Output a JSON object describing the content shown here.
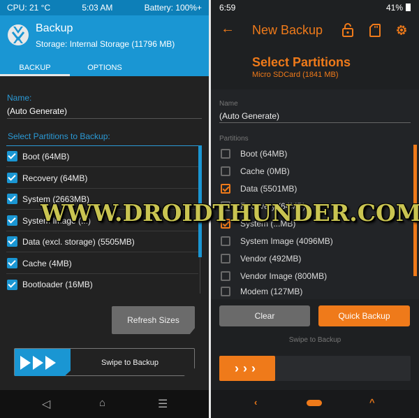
{
  "left": {
    "status": {
      "cpu": "CPU: 21 °C",
      "time": "5:03 AM",
      "battery": "Battery: 100%+"
    },
    "header": {
      "title": "Backup",
      "storage": "Storage: Internal Storage (11796 MB)"
    },
    "tabs": [
      {
        "label": "BACKUP",
        "active": true
      },
      {
        "label": "OPTIONS",
        "active": false
      }
    ],
    "name_label": "Name:",
    "name_value": "(Auto Generate)",
    "partitions_label": "Select Partitions to Backup:",
    "partitions": [
      {
        "label": "Boot (64MB)",
        "checked": true
      },
      {
        "label": "Recovery (64MB)",
        "checked": true
      },
      {
        "label": "System (2663MB)",
        "checked": true
      },
      {
        "label": "System Image (...)",
        "checked": true
      },
      {
        "label": "Data (excl. storage) (5505MB)",
        "checked": true
      },
      {
        "label": "Cache (4MB)",
        "checked": true
      },
      {
        "label": "Bootloader (16MB)",
        "checked": true
      }
    ],
    "refresh_button": "Refresh Sizes",
    "swipe_label": "Swipe to Backup",
    "accent": "#1a96d3"
  },
  "right": {
    "status": {
      "time": "6:59",
      "battery": "41%"
    },
    "title": "New Backup",
    "icons": [
      "back-arrow-icon",
      "unlock-icon",
      "sdcard-icon",
      "gear-icon"
    ],
    "section_title": "Select Partitions",
    "section_sub": "Micro SDCard (1841 MB)",
    "name_label": "Name",
    "name_value": "(Auto Generate)",
    "partitions_label": "Partitions",
    "partitions": [
      {
        "label": "Boot (64MB)",
        "checked": false
      },
      {
        "label": "Cache (0MB)",
        "checked": false
      },
      {
        "label": "Data (5501MB)",
        "checked": true
      },
      {
        "label": "Recovery (64MB)",
        "checked": false
      },
      {
        "label": "System (...MB)",
        "checked": true
      },
      {
        "label": "System Image (4096MB)",
        "checked": false
      },
      {
        "label": "Vendor (492MB)",
        "checked": false
      },
      {
        "label": "Vendor Image (800MB)",
        "checked": false
      },
      {
        "label": "Modem (127MB)",
        "checked": false
      }
    ],
    "clear_button": "Clear",
    "quick_backup_button": "Quick Backup",
    "swipe_label": "Swipe to Backup",
    "swipe_arrows": "›››",
    "accent": "#ef7a1a"
  },
  "watermark": "WWW.DROIDTHUNDER.COM"
}
